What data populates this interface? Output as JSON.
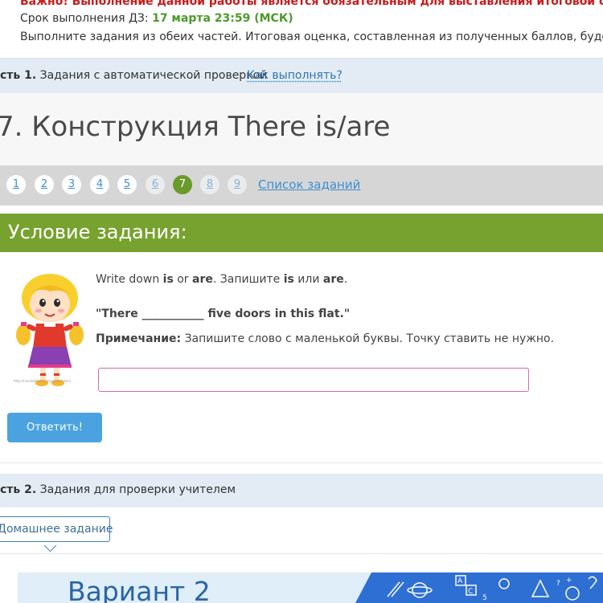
{
  "notice": {
    "warning": "Важно! Выполнение данной работы является обязательным для выставления итоговой оценки за четверть.",
    "deadline_label": "Срок выполнения ДЗ: ",
    "deadline_value": "17 марта 23:59 (МСК)",
    "instructions": "Выполните задания из обеих частей. Итоговая оценка, составленная из полученных баллов, будет выставлен"
  },
  "part1": {
    "label_bold": "сть 1.",
    "label_text": " Задания с автоматической проверкой",
    "how_link": "Как выполнять?"
  },
  "page_title": "7. Конструкция There is/are",
  "pager": {
    "pages": [
      "1",
      "2",
      "3",
      "4",
      "5",
      "6",
      "7",
      "8",
      "9"
    ],
    "active": "7",
    "task_list_link": "Список заданий"
  },
  "condition": {
    "header": "Условие задания:",
    "image_caption": "http://nicolaslibre.com/pages/kids/1",
    "line1_a": "Write down ",
    "line1_is": "is",
    "line1_or": " or ",
    "line1_are": "are",
    "line1_b": ". Запишите ",
    "line1_is2": "is",
    "line1_ili": " или ",
    "line1_are2": "are",
    "line1_end": ".",
    "sentence": "\"There ___________ five doors in this flat.\"",
    "note_label": "Примечание:",
    "note_text": " Запишите слово с маленькой буквы. Точку ставить не нужно.",
    "input_value": "",
    "submit_label": "Ответить!"
  },
  "part2": {
    "label_bold": "сть 2.",
    "label_text": " Задания для проверки учителем"
  },
  "homework_tab": "Домашнее задание",
  "variant_title": "Вариант 2",
  "colors": {
    "accent_green": "#78a22f",
    "link_blue": "#3d8fcf",
    "warning_red": "#c91b1b",
    "submit_blue": "#4aa3e0"
  }
}
